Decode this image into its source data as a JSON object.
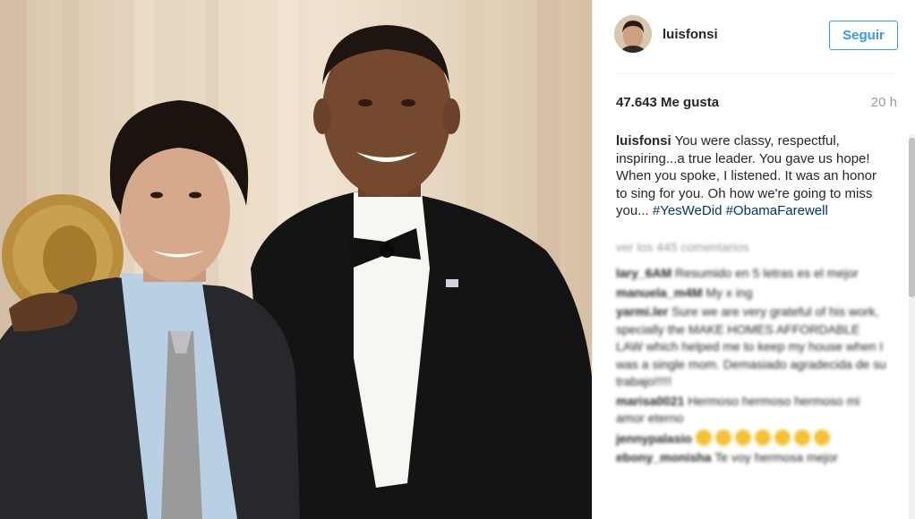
{
  "post": {
    "username": "luisfonsi",
    "follow_label": "Seguir",
    "likes": "47.643 Me gusta",
    "time": "20 h",
    "caption": {
      "user": "luisfonsi",
      "text": "You were classy, respectful, inspiring...a true leader. You gave us hope! When you spoke, I listened. It was an honor to sing for you. Oh how we're going to miss you...",
      "hashtags": [
        "#YesWeDid",
        "#ObamaFarewell"
      ]
    },
    "more_comments": "ver los 445 comentarios"
  },
  "comments": [
    {
      "user": "lary_6AM",
      "text": "Resumido en 5 letras es el mejor"
    },
    {
      "user": "manuela_m4M",
      "text": "My x ing"
    },
    {
      "user": "yarmi.ler",
      "text": "Sure we are very grateful of his work, specially the MAKE HOMES AFFORDABLE LAW which helped me to keep my house when I was a single mom. Demasiado agradecida de su trabajo!!!!!"
    },
    {
      "user": "marisa0021",
      "text": "Hermoso hermoso hermoso mi amor eterno"
    },
    {
      "user": "jennypalasio",
      "text": ""
    },
    {
      "user": "ebony_monisha",
      "text": "Te voy hermosa mejor"
    }
  ],
  "colors": {
    "accent": "#3897f0",
    "hashtag": "#003569",
    "muted": "#999999",
    "text": "#262626"
  }
}
